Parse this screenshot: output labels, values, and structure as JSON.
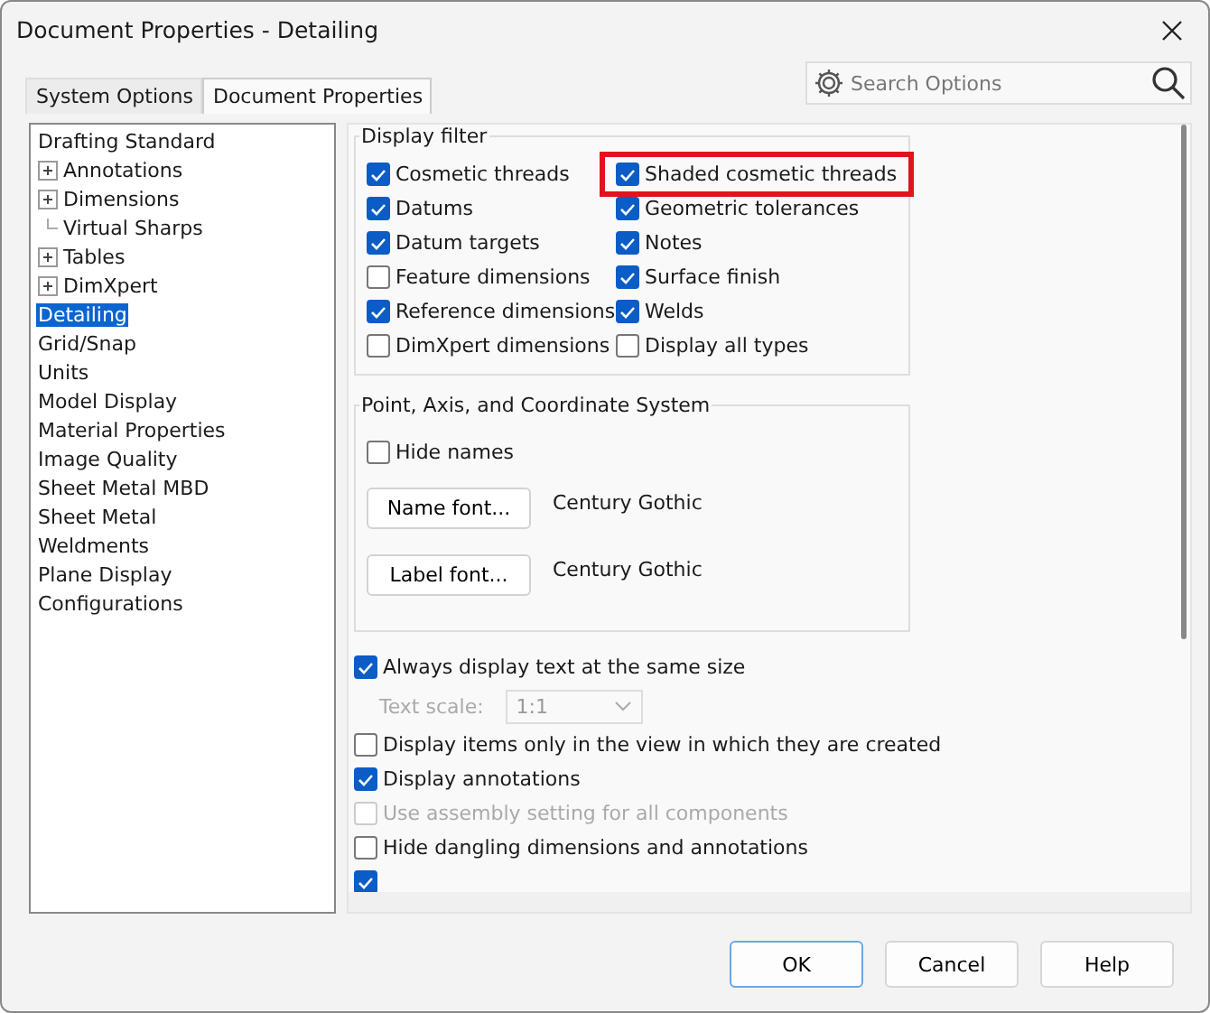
{
  "window": {
    "title": "Document Properties - Detailing"
  },
  "tabs": [
    {
      "label": "System Options",
      "selected": false
    },
    {
      "label": "Document Properties",
      "selected": true
    }
  ],
  "search": {
    "placeholder": "Search Options"
  },
  "tree": [
    {
      "label": "Drafting Standard",
      "kind": "plain",
      "selected": false
    },
    {
      "label": "Annotations",
      "kind": "expandable",
      "selected": false
    },
    {
      "label": "Dimensions",
      "kind": "expandable",
      "selected": false
    },
    {
      "label": "Virtual Sharps",
      "kind": "connector",
      "selected": false
    },
    {
      "label": "Tables",
      "kind": "expandable",
      "selected": false
    },
    {
      "label": "DimXpert",
      "kind": "expandable",
      "selected": false
    },
    {
      "label": "Detailing",
      "kind": "plain",
      "selected": true
    },
    {
      "label": "Grid/Snap",
      "kind": "plain",
      "selected": false
    },
    {
      "label": "Units",
      "kind": "plain",
      "selected": false
    },
    {
      "label": "Model Display",
      "kind": "plain",
      "selected": false
    },
    {
      "label": "Material Properties",
      "kind": "plain",
      "selected": false
    },
    {
      "label": "Image Quality",
      "kind": "plain",
      "selected": false
    },
    {
      "label": "Sheet Metal MBD",
      "kind": "plain",
      "selected": false
    },
    {
      "label": "Sheet Metal",
      "kind": "plain",
      "selected": false
    },
    {
      "label": "Weldments",
      "kind": "plain",
      "selected": false
    },
    {
      "label": "Plane Display",
      "kind": "plain",
      "selected": false
    },
    {
      "label": "Configurations",
      "kind": "plain",
      "selected": false
    }
  ],
  "display_filter": {
    "title": "Display filter",
    "columns": [
      {
        "options": [
          {
            "label": "Cosmetic threads",
            "checked": true,
            "highlighted": false
          },
          {
            "label": "Datums",
            "checked": true,
            "highlighted": false
          },
          {
            "label": "Datum targets",
            "checked": true,
            "highlighted": false
          },
          {
            "label": "Feature dimensions",
            "checked": false,
            "highlighted": false
          },
          {
            "label": "Reference dimensions",
            "checked": true,
            "highlighted": false
          },
          {
            "label": "DimXpert dimensions",
            "checked": false,
            "highlighted": false
          }
        ]
      },
      {
        "options": [
          {
            "label": "Shaded cosmetic threads",
            "checked": true,
            "highlighted": true
          },
          {
            "label": "Geometric tolerances",
            "checked": true,
            "highlighted": false
          },
          {
            "label": "Notes",
            "checked": true,
            "highlighted": false
          },
          {
            "label": "Surface finish",
            "checked": true,
            "highlighted": false
          },
          {
            "label": "Welds",
            "checked": true,
            "highlighted": false
          },
          {
            "label": "Display all types",
            "checked": false,
            "highlighted": false
          }
        ]
      }
    ]
  },
  "point_axis": {
    "title": "Point, Axis, and Coordinate System",
    "hide_names": {
      "label": "Hide names",
      "checked": false
    },
    "fonts": [
      {
        "button": "Name font...",
        "value": "Century Gothic"
      },
      {
        "button": "Label font...",
        "value": "Century Gothic"
      }
    ]
  },
  "options": [
    {
      "kind": "checkbox",
      "label": "Always display text at the same size",
      "checked": true,
      "disabled": false
    },
    {
      "kind": "scale",
      "label": "Text scale:",
      "value": "1:1",
      "disabled": true
    },
    {
      "kind": "checkbox",
      "label": "Display items only in the view in which they are created",
      "checked": false,
      "disabled": false
    },
    {
      "kind": "checkbox",
      "label": "Display annotations",
      "checked": true,
      "disabled": false
    },
    {
      "kind": "checkbox",
      "label": "Use assembly setting for all components",
      "checked": false,
      "disabled": true
    },
    {
      "kind": "checkbox",
      "label": "Hide dangling dimensions and annotations",
      "checked": false,
      "disabled": false
    },
    {
      "kind": "checkbox",
      "checked": true
    }
  ],
  "buttons": [
    {
      "label": "OK",
      "default": true
    },
    {
      "label": "Cancel",
      "default": false
    },
    {
      "label": "Help",
      "default": false
    }
  ]
}
